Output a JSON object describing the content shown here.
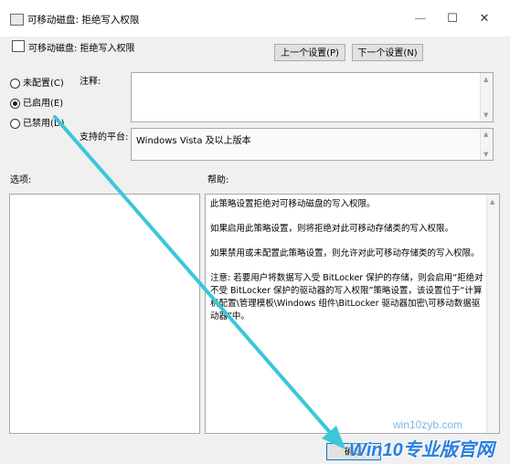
{
  "window": {
    "title": "可移动磁盘: 拒绝写入权限",
    "minimize": "—",
    "maximize": "☐",
    "close": "✕"
  },
  "header": {
    "setting_name": "可移动磁盘: 拒绝写入权限",
    "prev_button": "上一个设置(P)",
    "next_button": "下一个设置(N)"
  },
  "state": {
    "not_configured": "未配置(C)",
    "enabled": "已启用(E)",
    "disabled": "已禁用(D)",
    "selected": "enabled"
  },
  "comment": {
    "label": "注释:",
    "value": ""
  },
  "platform": {
    "label": "支持的平台:",
    "value": "Windows Vista 及以上版本"
  },
  "options": {
    "label": "选项:"
  },
  "help": {
    "label": "帮助:",
    "paragraphs": [
      "此策略设置拒绝对可移动磁盘的写入权限。",
      "如果启用此策略设置，则将拒绝对此可移动存储类的写入权限。",
      "如果禁用或未配置此策略设置，则允许对此可移动存储类的写入权限。",
      "注意: 若要用户将数据写入受 BitLocker 保护的存储，则会启用“拒绝对不受 BitLocker 保护的驱动器的写入权限”策略设置，该设置位于“计算机配置\\管理模板\\Windows 组件\\BitLocker 驱动器加密\\可移动数据驱动器”中。"
    ]
  },
  "footer": {
    "ok_button": "确定"
  },
  "watermark": {
    "url": "win10zyb.com",
    "brand": "Win10专业版官网"
  },
  "colors": {
    "arrow": "#3cc6d8",
    "watermark": "#2a7fe0"
  }
}
